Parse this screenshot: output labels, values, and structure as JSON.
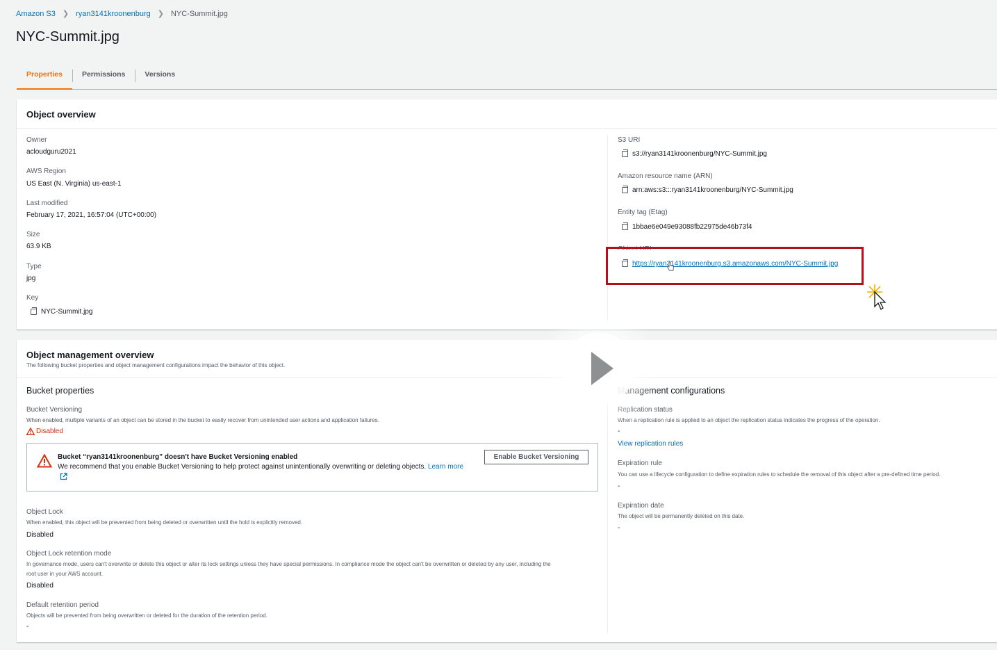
{
  "breadcrumb": {
    "root": "Amazon S3",
    "bucket": "ryan3141kroonenburg",
    "current": "NYC-Summit.jpg"
  },
  "page_title": "NYC-Summit.jpg",
  "tabs": [
    {
      "label": "Properties"
    },
    {
      "label": "Permissions"
    },
    {
      "label": "Versions"
    }
  ],
  "overview": {
    "title": "Object overview",
    "owner": {
      "label": "Owner",
      "value": "acloudguru2021"
    },
    "region": {
      "label": "AWS Region",
      "value": "US East (N. Virginia) us-east-1"
    },
    "modified": {
      "label": "Last modified",
      "value": "February 17, 2021, 16:57:04 (UTC+00:00)"
    },
    "size": {
      "label": "Size",
      "value": "63.9 KB"
    },
    "type": {
      "label": "Type",
      "value": "jpg"
    },
    "key": {
      "label": "Key",
      "value": "NYC-Summit.jpg"
    },
    "s3uri": {
      "label": "S3 URI",
      "value": "s3://ryan3141kroonenburg/NYC-Summit.jpg"
    },
    "arn": {
      "label": "Amazon resource name (ARN)",
      "value": "arn:aws:s3:::ryan3141kroonenburg/NYC-Summit.jpg"
    },
    "etag": {
      "label": "Entity tag (Etag)",
      "value": "1bbae6e049e93088fb22975de46b73f4"
    },
    "url": {
      "label": "Object URL",
      "value": "https://ryan3141kroonenburg.s3.amazonaws.com/NYC-Summit.jpg"
    }
  },
  "management": {
    "title": "Object management overview",
    "subtitle": "The following bucket properties and object management configurations impact the behavior of this object.",
    "bucket_props": {
      "title": "Bucket properties",
      "versioning": {
        "label": "Bucket Versioning",
        "desc": "When enabled, multiple variants of an object can be stored in the bucket to easily recover from unintended user actions and application failures.",
        "status": "Disabled"
      },
      "warning": {
        "title": "Bucket “ryan3141kroonenburg” doesn't have Bucket Versioning enabled",
        "body": "We recommend that you enable Bucket Versioning to help protect against unintentionally overwriting or deleting objects.",
        "learn_more": "Learn more",
        "button": "Enable Bucket Versioning"
      },
      "lock": {
        "label": "Object Lock",
        "desc": "When enabled, this object will be prevented from being deleted or overwritten until the hold is explicitly removed.",
        "value": "Disabled"
      },
      "retention_mode": {
        "label": "Object Lock retention mode",
        "desc1": "In governance mode, users can't overwrite or delete this object or alter its lock settings unless they have special permissions. In compliance mode the object can't be overwritten or deleted by any user, including the",
        "desc2": "root user in your AWS account.",
        "value": "Disabled"
      },
      "retention_period": {
        "label": "Default retention period",
        "desc": "Objects will be prevented from being overwritten or deleted for the duration of the retention period.",
        "value": "-"
      }
    },
    "configs": {
      "title": "Management configurations",
      "replication": {
        "label": "Replication status",
        "desc": "When a replication rule is applied to an object the replication status indicates the progress of the operation.",
        "value": "-",
        "link": "View replication rules"
      },
      "expiration_rule": {
        "label": "Expiration rule",
        "desc": "You can use a lifecycle configuration to define expiration rules to schedule the removal of this object after a pre-defined time period.",
        "value": "-"
      },
      "expiration_date": {
        "label": "Expiration date",
        "desc": "The object will be permanently deleted on this date.",
        "value": "-"
      }
    }
  },
  "colors": {
    "accent": "#ec7211",
    "link": "#0073bb",
    "danger": "#d13212",
    "highlight": "#b0121c"
  }
}
